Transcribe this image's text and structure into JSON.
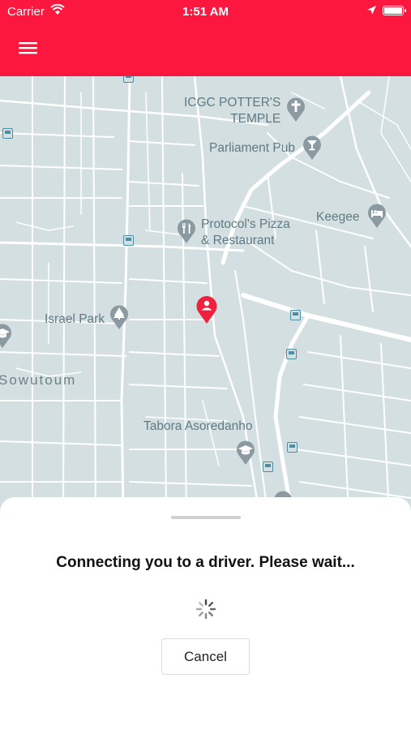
{
  "status_bar": {
    "carrier": "Carrier",
    "time": "1:51 AM"
  },
  "colors": {
    "brand_red": "#fb173d",
    "map_background": "#d4dfe1",
    "street": "#ffffff",
    "poi_label": "#5f7a84",
    "poi_icon": "#8b9aa0",
    "user_pin": "#f0213f",
    "transit_icon": "#4b8fa6"
  },
  "map": {
    "labels": {
      "icgc": "ICGC POTTER'S\nTEMPLE",
      "parliament_pub": "Parliament Pub",
      "keegee": "Keegee",
      "protocols_pizza": "Protocol's Pizza\n& Restaurant",
      "israel_park": "Israel Park",
      "sowutoum": "Sowutoum",
      "tabora": "Tabora Asoredanho"
    },
    "icons": {
      "church": "cross-icon",
      "pub": "cocktail-icon",
      "lodging": "bed-icon",
      "restaurant": "fork-knife-icon",
      "park": "tree-icon",
      "school": "graduation-cap-icon",
      "transit": "bus-stop-icon",
      "user": "user-location-pin-icon"
    }
  },
  "sheet": {
    "message": "Connecting you to a driver. Please wait...",
    "cancel_label": "Cancel"
  }
}
